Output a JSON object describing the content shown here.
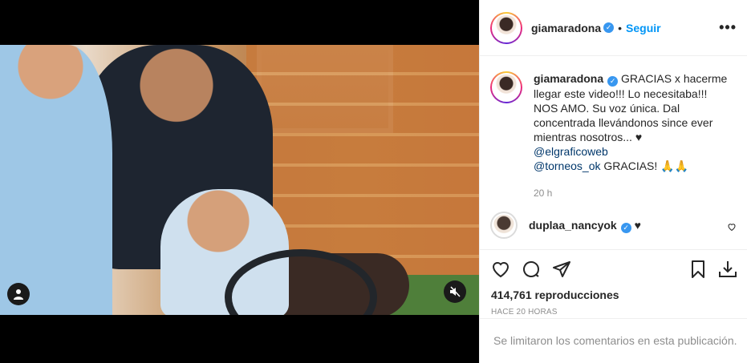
{
  "post": {
    "username": "giamaradona",
    "follow_label": "Seguir",
    "more_label": "•••",
    "caption_lines": [
      "GRACIAS x hacerme",
      "llegar este video!!! Lo necesitaba!!!",
      "NOS AMO. Su voz única. Dal",
      "concentrada llevándonos since ever",
      "mientras nosotros... ♥"
    ],
    "mentions": [
      "@elgraficoweb",
      "@torneos_ok"
    ],
    "caption_end": "GRACIAS! 🙏🙏",
    "caption_time": "20 h"
  },
  "comments": [
    {
      "username": "duplaa_nancyok",
      "text": "♥"
    }
  ],
  "stats": {
    "views": "414,761 reproducciones",
    "posted": "HACE 20 HORAS"
  },
  "footer": {
    "limited_text": "Se limitaron los comentarios en esta publicación."
  },
  "icons": {
    "user_tag": "user-icon",
    "mute": "muted-speaker-icon",
    "like": "heart-icon",
    "comment": "comment-icon",
    "share": "send-icon",
    "save": "bookmark-icon",
    "download": "download-icon"
  }
}
